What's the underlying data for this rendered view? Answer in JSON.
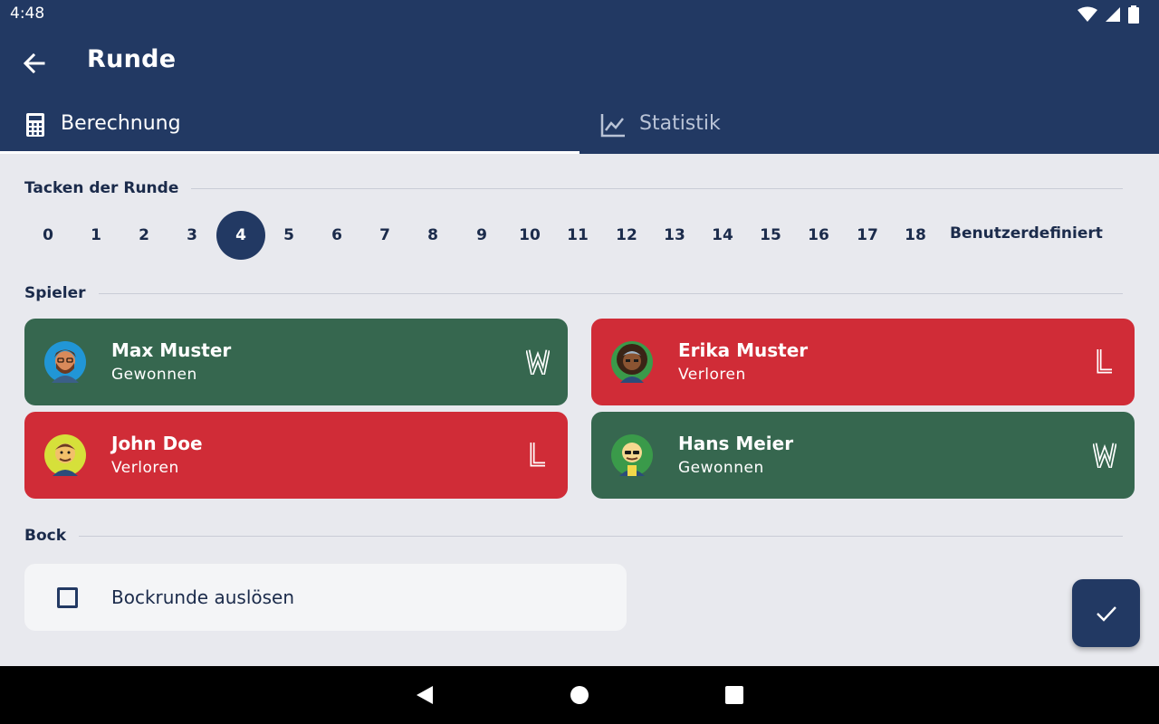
{
  "status_bar": {
    "time": "4:48",
    "icons": [
      "wifi-icon",
      "signal-icon",
      "battery-icon"
    ]
  },
  "app_bar": {
    "title": "Runde",
    "back_icon": "arrow-left-icon"
  },
  "tabs": [
    {
      "label": "Berechnung",
      "icon": "calculator-icon",
      "selected": true
    },
    {
      "label": "Statistik",
      "icon": "line-chart-icon",
      "selected": false
    }
  ],
  "tacken_section": {
    "title": "Tacken der Runde",
    "options": [
      "0",
      "1",
      "2",
      "3",
      "4",
      "5",
      "6",
      "7",
      "8",
      "9",
      "10",
      "11",
      "12",
      "13",
      "14",
      "15",
      "16",
      "17",
      "18"
    ],
    "selected": "4",
    "custom_label": "Benutzerdefiniert"
  },
  "players_section": {
    "title": "Spieler",
    "players": [
      {
        "name": "Max Muster",
        "status": "Gewonnen",
        "badge": "W",
        "result": "win"
      },
      {
        "name": "Erika Muster",
        "status": "Verloren",
        "badge": "L",
        "result": "loss"
      },
      {
        "name": "John Doe",
        "status": "Verloren",
        "badge": "L",
        "result": "loss"
      },
      {
        "name": "Hans Meier",
        "status": "Gewonnen",
        "badge": "W",
        "result": "win"
      }
    ]
  },
  "bock_section": {
    "title": "Bock",
    "checkbox_label": "Bockrunde auslösen",
    "checked": false
  },
  "fab": {
    "icon": "check-icon"
  },
  "colors": {
    "primary": "#223963",
    "win": "#36674f",
    "loss": "#d02c37",
    "background": "#e8e9ee"
  }
}
